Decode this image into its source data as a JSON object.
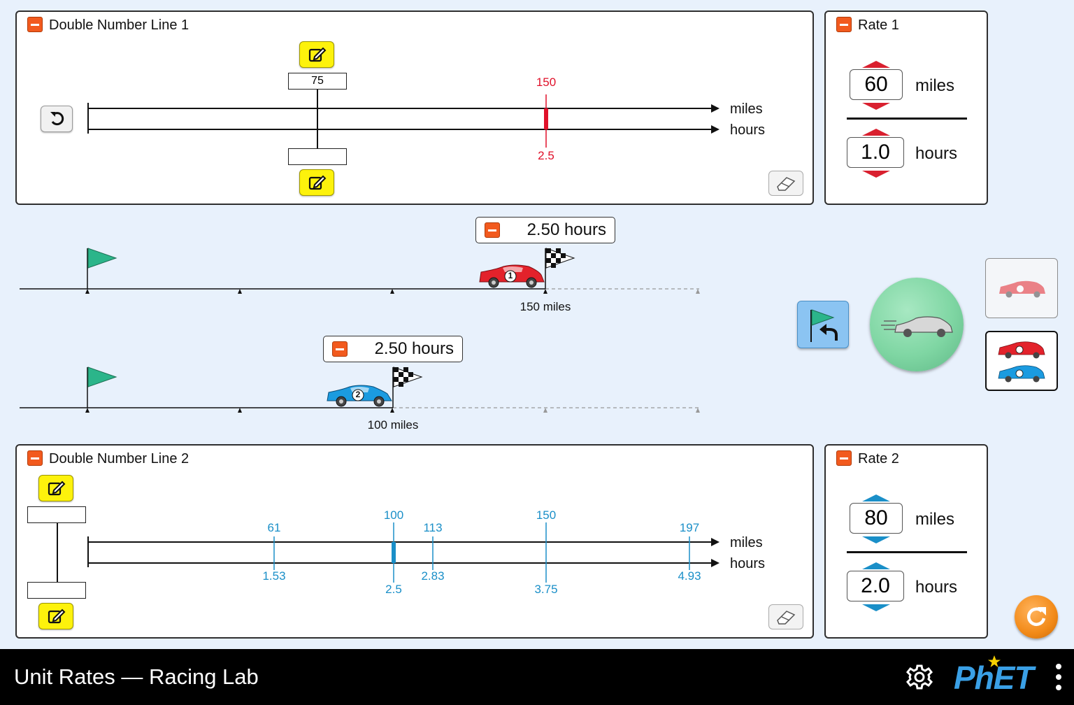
{
  "app_title": "Unit Rates — Racing Lab",
  "dnl1": {
    "title": "Double Number Line 1",
    "edit_top_value": "75",
    "edit_bottom_value": "",
    "units_top": "miles",
    "units_bottom": "hours",
    "marker_top": "150",
    "marker_bottom": "2.5",
    "marker_color": "#e0112a"
  },
  "rate1": {
    "title": "Rate 1",
    "top_value": "60",
    "top_unit": "miles",
    "bottom_value": "1.0",
    "bottom_unit": "hours",
    "arrow_color": "#d9202f"
  },
  "race1": {
    "timer": "2.50 hours",
    "distance_label": "150 miles",
    "car_number": "1",
    "car_color": "#e3222b"
  },
  "race2": {
    "timer": "2.50 hours",
    "distance_label": "100 miles",
    "car_number": "2",
    "car_color": "#1b9be0"
  },
  "dnl2": {
    "title": "Double Number Line 2",
    "edit_top_value": "",
    "edit_bottom_value": "",
    "units_top": "miles",
    "units_bottom": "hours",
    "marker_color": "#1a8fc8",
    "markers": [
      {
        "top": "61",
        "bottom": "1.53"
      },
      {
        "top": "100",
        "bottom": "2.5"
      },
      {
        "top": "113",
        "bottom": "2.83"
      },
      {
        "top": "150",
        "bottom": "3.75"
      },
      {
        "top": "197",
        "bottom": "4.93"
      }
    ]
  },
  "rate2": {
    "title": "Rate 2",
    "top_value": "80",
    "top_unit": "miles",
    "bottom_value": "2.0",
    "bottom_unit": "hours",
    "arrow_color": "#1a8fc8"
  },
  "colors": {
    "start_flag": "#2bb58a",
    "play_button": "#7fd6a3",
    "reset_button": "#f28a18",
    "background": "#e8f1fc"
  },
  "icons": [
    "undo-icon",
    "pencil-icon",
    "eraser-icon",
    "start-flag-icon",
    "finish-flag-icon",
    "return-flag-icon",
    "gear-icon",
    "more-icon",
    "phet-logo",
    "reset-all-icon"
  ],
  "logo_text": "PhET"
}
